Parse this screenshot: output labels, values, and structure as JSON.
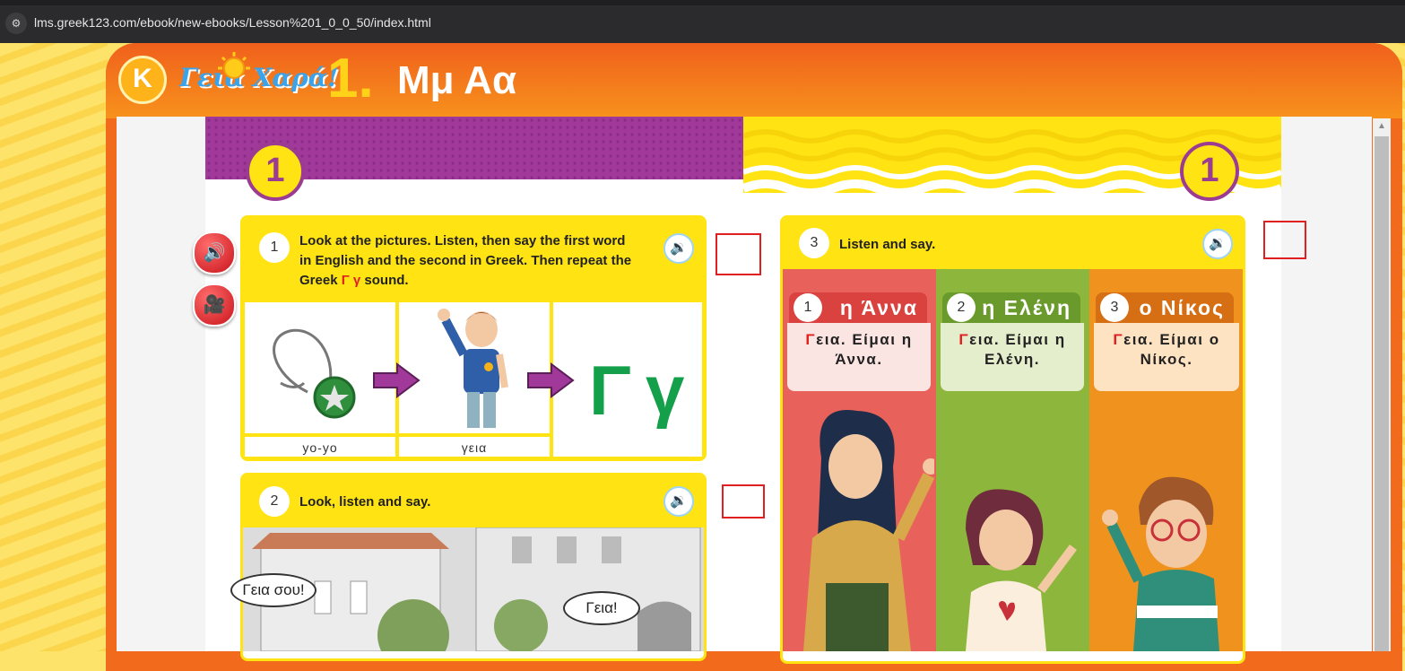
{
  "browser": {
    "url": "lms.greek123.com/ebook/new-ebooks/Lesson%201_0_0_50/index.html",
    "site_icon": "site-settings-icon"
  },
  "header": {
    "logo_letter": "K",
    "logo_text": "Γεια Χαρά!",
    "lesson_number": "1.",
    "lesson_title": "Μμ Αα"
  },
  "page": {
    "left_badge": "1",
    "right_badge": "1",
    "side_buttons": [
      {
        "icon": "speaker-icon"
      },
      {
        "icon": "video-camera-icon"
      }
    ]
  },
  "activity1": {
    "number": "1",
    "instruction_line1": "Look at the pictures. Listen, then say the first word",
    "instruction_line2": "in English and the second in Greek. Then repeat the",
    "instruction_pre": "Greek ",
    "instruction_letters": "Γ γ",
    "instruction_post": " sound.",
    "audio_icon": "audio-icon",
    "captions": [
      "yo-yo",
      "γεια"
    ],
    "letter_upper": "Γ",
    "letter_lower": "γ"
  },
  "activity2": {
    "number": "2",
    "instruction": "Look, listen and say.",
    "audio_icon": "audio-icon",
    "bubble1": "Γεια σου!",
    "bubble2": "Γεια!"
  },
  "activity3": {
    "number": "3",
    "instruction": "Listen and say.",
    "audio_icon": "audio-icon",
    "characters": [
      {
        "num": "1",
        "name": "η Άννα",
        "g": "Γ",
        "line1": "εια. Είμαι η",
        "line2": "Άννα.",
        "color": "#e8615a"
      },
      {
        "num": "2",
        "name": "η Ελένη",
        "g": "Γ",
        "line1": "εια. Είμαι η",
        "line2": "Ελένη.",
        "color": "#8cb63c"
      },
      {
        "num": "3",
        "name": "ο Νίκος",
        "g": "Γ",
        "line1": "εια. Είμαι ο",
        "line2": "Νίκος.",
        "color": "#f0921e"
      }
    ]
  },
  "colors": {
    "header_orange": "#f26b1d",
    "panel_yellow": "#ffe312",
    "band_purple": "#a0399a",
    "greek_letter_green": "#14a04a",
    "highlight_red": "#e0201e"
  }
}
